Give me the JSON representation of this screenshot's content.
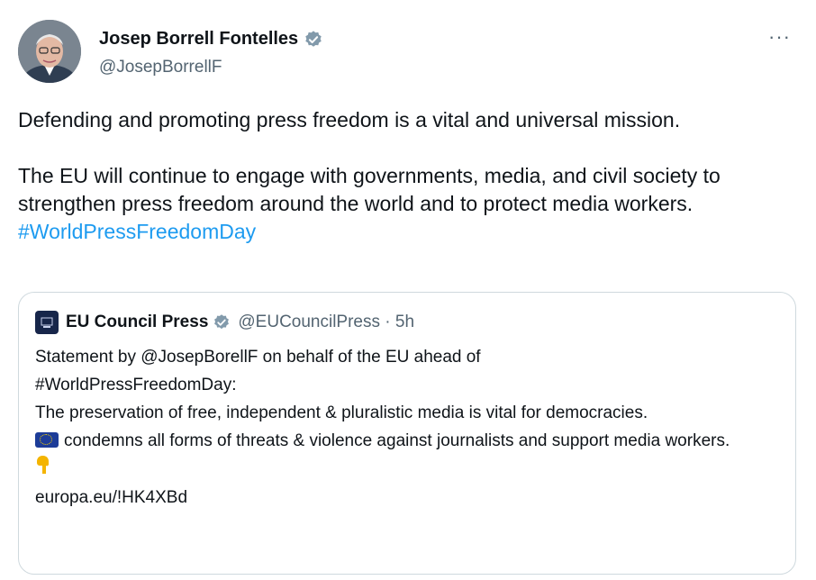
{
  "author": {
    "name": "Josep Borrell Fontelles",
    "handle": "@JosepBorrellF",
    "verified_icon": "verified-badge-icon",
    "more_label": "···"
  },
  "tweet": {
    "line1": "Defending and promoting press freedom is a vital and universal mission.",
    "line2": "The EU will continue to engage with governments, media, and civil society to strengthen press freedom around the world and to protect media workers.",
    "hashtag": "#WorldPressFreedomDay"
  },
  "quote": {
    "name": "EU Council Press",
    "handle_time": "@EUCouncilPress · 5h",
    "lines": [
      "Statement by @JosepBorellF on behalf of the EU ahead of",
      "#WorldPressFreedomDay:",
      "The preservation of free, independent & pluralistic media is vital for democracies.",
      "condemns all forms of threats & violence against journalists and support media workers.",
      "europa.eu/!HK4XBd"
    ],
    "flag_icon": "eu-flag-icon",
    "pointer_icon": "backhand-index-pointing-down-icon"
  },
  "colors": {
    "text": "#0f1419",
    "muted": "#536471",
    "link": "#1d9bf0",
    "verified": "#829aab",
    "border": "#cfd9de"
  }
}
